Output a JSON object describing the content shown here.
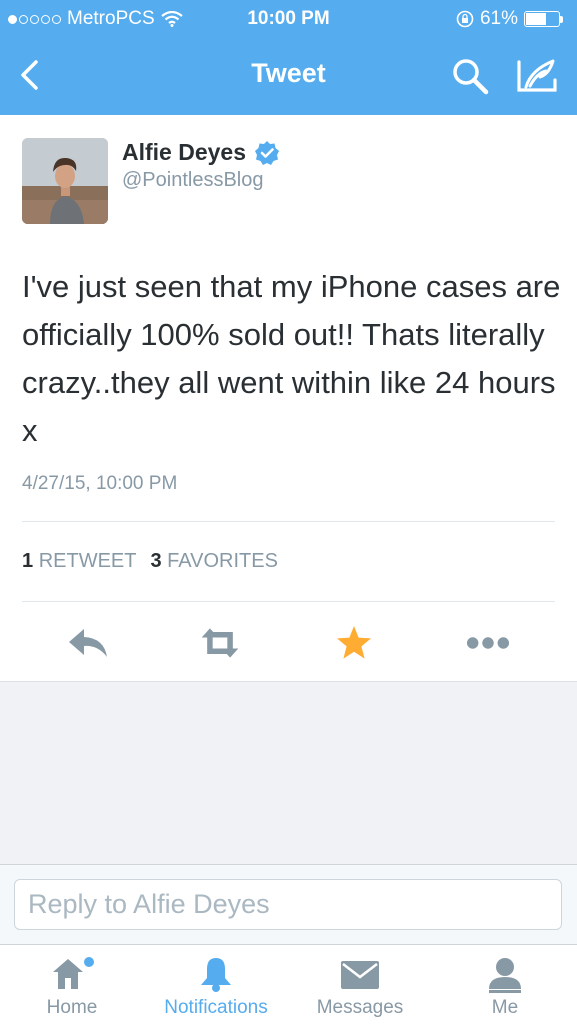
{
  "status_bar": {
    "carrier": "MetroPCS",
    "time": "10:00 PM",
    "battery": "61%"
  },
  "nav": {
    "title": "Tweet"
  },
  "tweet": {
    "name": "Alfie Deyes",
    "handle": "@PointlessBlog",
    "text": "I've just seen that my iPhone cases are officially 100% sold out!! Thats literally crazy..they all went within like 24 hours x",
    "timestamp": "4/27/15, 10:00 PM",
    "retweet_count": "1",
    "retweet_label": "RETWEET",
    "favorite_count": "3",
    "favorite_label": "FAVORITES"
  },
  "reply": {
    "placeholder": "Reply to Alfie Deyes"
  },
  "tabs": [
    {
      "label": "Home"
    },
    {
      "label": "Notifications"
    },
    {
      "label": "Messages"
    },
    {
      "label": "Me"
    }
  ],
  "colors": {
    "brand": "#55acee",
    "favorite": "#ffac33",
    "icon_gray": "#8899a6"
  }
}
